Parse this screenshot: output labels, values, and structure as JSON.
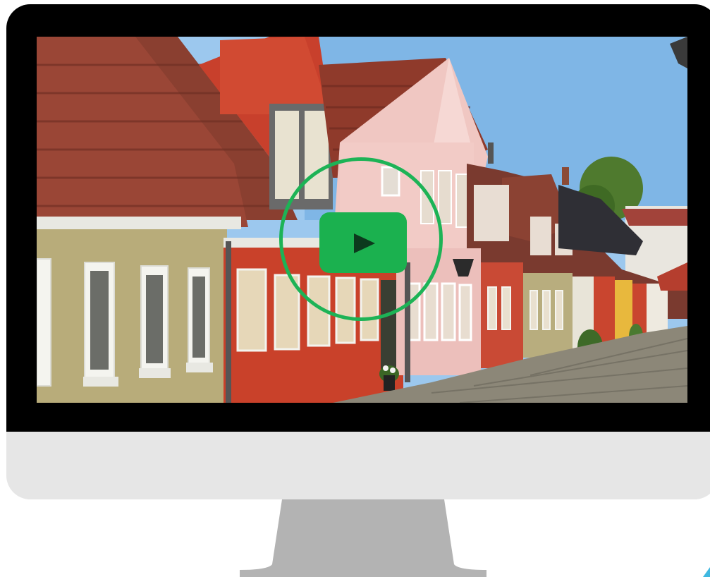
{
  "video": {
    "state": "paused",
    "thumbnail_scene": "street-of-colorful-old-houses",
    "play_icon": "play-icon"
  },
  "device": {
    "type": "desktop-monitor"
  },
  "colors": {
    "bezel": "#000000",
    "chin": "#e6e6e6",
    "stand": "#b3b3b3",
    "accent_green": "#1bb14f",
    "ring_green": "#1db356",
    "corner_accent": "#3fb8e0"
  }
}
